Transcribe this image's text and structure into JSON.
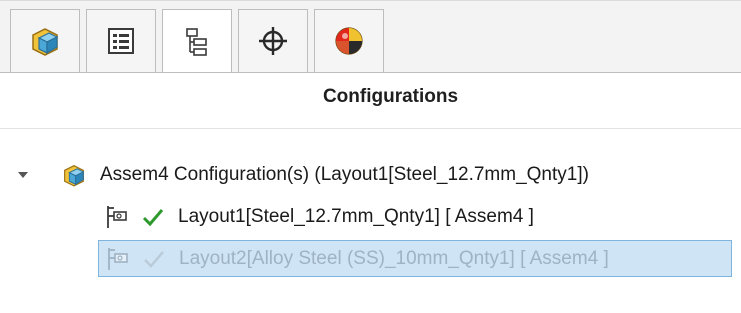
{
  "panel": {
    "title": "Configurations",
    "tabs": [
      {
        "name": "featuremanager-tab",
        "icon": "assembly-icon",
        "active": false
      },
      {
        "name": "propertymanager-tab",
        "icon": "property-list-icon",
        "active": false
      },
      {
        "name": "configurationmanager-tab",
        "icon": "configuration-tree-icon",
        "active": true
      },
      {
        "name": "dimxpertmanager-tab",
        "icon": "crosshair-icon",
        "active": false
      },
      {
        "name": "displaymanager-tab",
        "icon": "color-sphere-icon",
        "active": false
      }
    ]
  },
  "tree": {
    "root": {
      "label": "Assem4 Configuration(s)  (Layout1[Steel_12.7mm_Qnty1])",
      "icon": "assembly-icon",
      "expanded": true
    },
    "configurations": [
      {
        "label": "Layout1[Steel_12.7mm_Qnty1] [ Assem4 ]",
        "icon": "configuration-icon",
        "active": true,
        "selected": false
      },
      {
        "label": "Layout2[Alloy Steel (SS)_10mm_Qnty1] [ Assem4 ]",
        "icon": "configuration-icon",
        "active": false,
        "selected": true
      }
    ]
  },
  "colors": {
    "selection_fill": "#cfe4f5",
    "selection_border": "#7fb4de",
    "check_green": "#2e9a2e"
  }
}
